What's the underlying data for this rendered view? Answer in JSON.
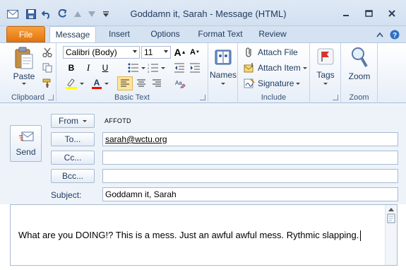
{
  "window": {
    "title": "Goddamn it, Sarah  -  Message (HTML)"
  },
  "ribbon_tabs": {
    "file": "File",
    "message": "Message",
    "insert": "Insert",
    "options": "Options",
    "format_text": "Format Text",
    "review": "Review"
  },
  "clipboard": {
    "label": "Clipboard",
    "paste": "Paste"
  },
  "basic_text": {
    "label": "Basic Text",
    "font": "Calibri (Body)",
    "size": "11",
    "bold": "B",
    "italic": "I",
    "underline": "U",
    "highlight_color": "#ffff00",
    "font_color": "#ff0000"
  },
  "names": {
    "label": "Names"
  },
  "include": {
    "label": "Include",
    "attach_file": "Attach File",
    "attach_item": "Attach Item",
    "signature": "Signature"
  },
  "tags": {
    "label": "Tags"
  },
  "zoom": {
    "label": "Zoom",
    "button": "Zoom"
  },
  "compose": {
    "send": "Send",
    "from_button": "From",
    "from_value": "AFFOTD",
    "to_button": "To...",
    "to_value": "sarah@wctu.org",
    "cc_button": "Cc...",
    "cc_value": "",
    "bcc_button": "Bcc...",
    "bcc_value": "",
    "subject_label": "Subject:",
    "subject_value": "Goddamn it, Sarah",
    "body": "What are you DOING!?  This is a mess.  Just an awful awful mess.  Rythmic slapping."
  }
}
